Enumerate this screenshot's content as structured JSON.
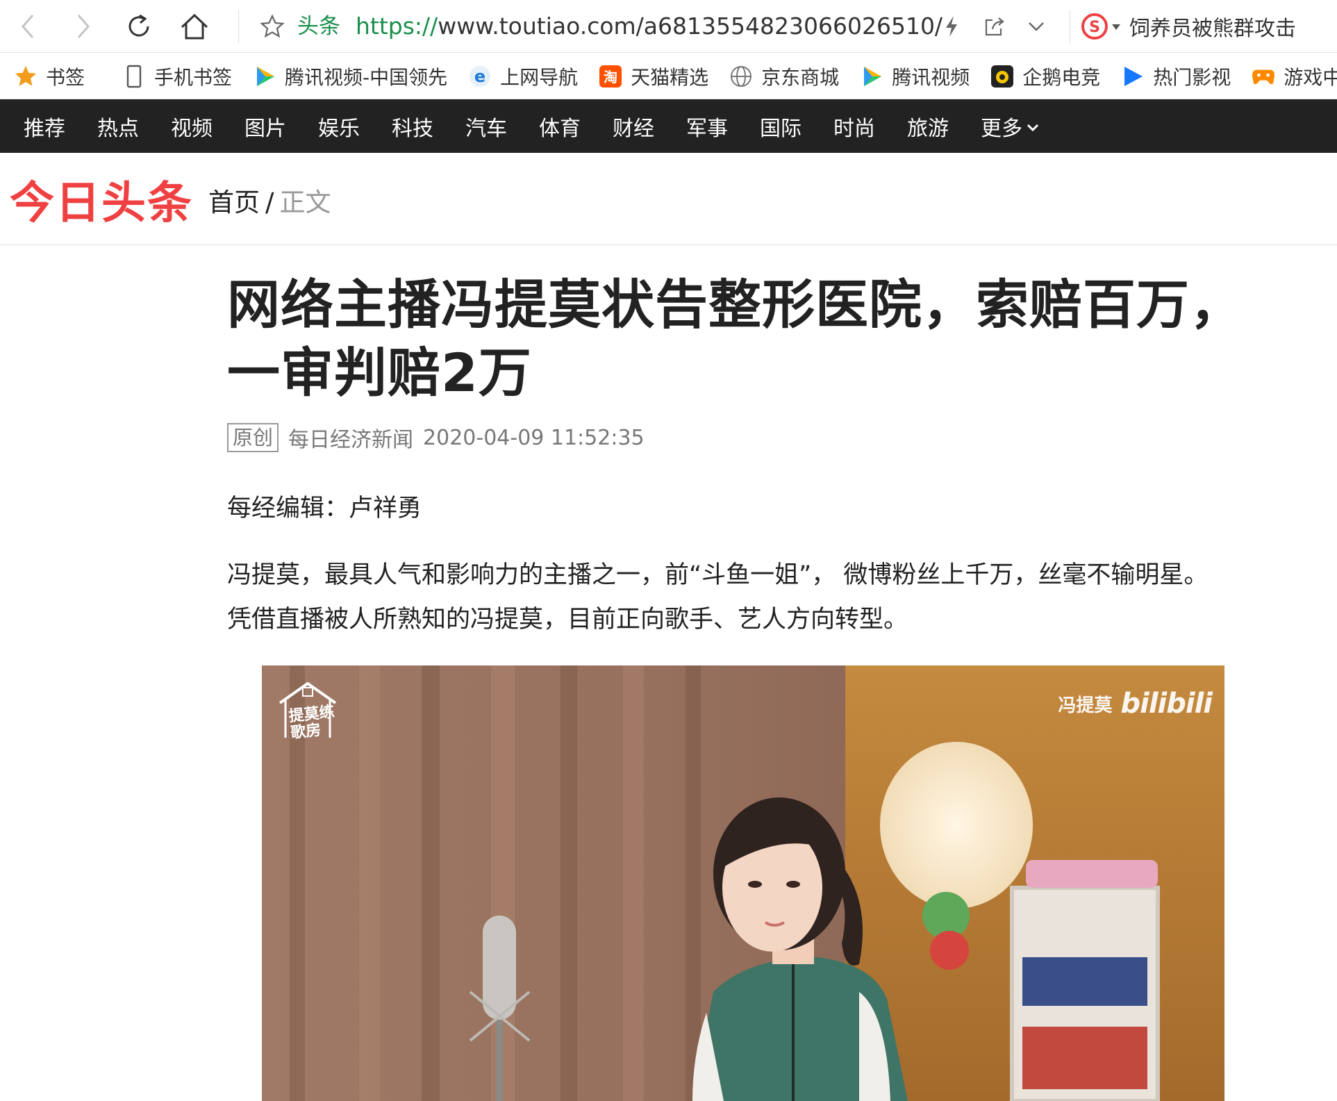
{
  "browser": {
    "site_label": "头条",
    "url_scheme": "https://",
    "url_rest": "www.toutiao.com/a6813554823066026510/",
    "search_text": "饲养员被熊群攻击"
  },
  "bookmarks": [
    {
      "label": "书签",
      "icon": "star-icon"
    },
    {
      "label": "手机书签",
      "icon": "phone-icon"
    },
    {
      "label": "腾讯视频-中国领先",
      "icon": "tencent-video-icon"
    },
    {
      "label": "上网导航",
      "icon": "ie-icon"
    },
    {
      "label": "天猫精选",
      "icon": "taobao-icon"
    },
    {
      "label": "京东商城",
      "icon": "globe-icon"
    },
    {
      "label": "腾讯视频",
      "icon": "tencent-video-icon"
    },
    {
      "label": "企鹅电竞",
      "icon": "penguin-esports-icon"
    },
    {
      "label": "热门影视",
      "icon": "hot-video-icon"
    },
    {
      "label": "游戏中心",
      "icon": "gamepad-icon"
    }
  ],
  "channels": [
    "推荐",
    "热点",
    "视频",
    "图片",
    "娱乐",
    "科技",
    "汽车",
    "体育",
    "财经",
    "军事",
    "国际",
    "时尚",
    "旅游",
    "更多"
  ],
  "header": {
    "logo": "今日头条",
    "crumb_home": "首页",
    "crumb_sep": "/",
    "crumb_current": "正文"
  },
  "article": {
    "title_line1": "网络主播冯提莫状告整形医院，索赔百万，",
    "title_line2": "一审判赔2万",
    "tag": "原创",
    "source": "每日经济新闻",
    "datetime": "2020-04-09 11:52:35",
    "editor": "每经编辑：卢祥勇",
    "para_line1": "冯提莫，最具人气和影响力的主播之一，前“斗鱼一姐”， 微博粉丝上千万，丝毫不输明星。",
    "para_line2": "凭借直播被人所熟知的冯提莫，目前正向歌手、艺人方向转型。"
  },
  "photo": {
    "watermark_left": "提莫练歌房",
    "watermark_name": "冯提莫",
    "watermark_brand": "bilibili"
  },
  "colors": {
    "brand_red": "#f04142",
    "nav_bg": "#222222",
    "url_green": "#1a8f4c"
  }
}
